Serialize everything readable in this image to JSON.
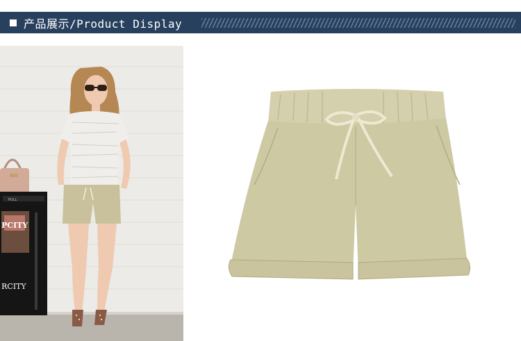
{
  "header": {
    "title": "产品展示/Product Display",
    "bar_color": "#27405e",
    "icon": "square-bullet-icon"
  },
  "photos": {
    "model_photo": {
      "sign_text": "PCITY",
      "sign_text_2": "RCITY",
      "bin_label": "PULL"
    },
    "product_photo": {
      "product": "khaki drawstring shorts",
      "color": "#cdc9a3"
    }
  }
}
